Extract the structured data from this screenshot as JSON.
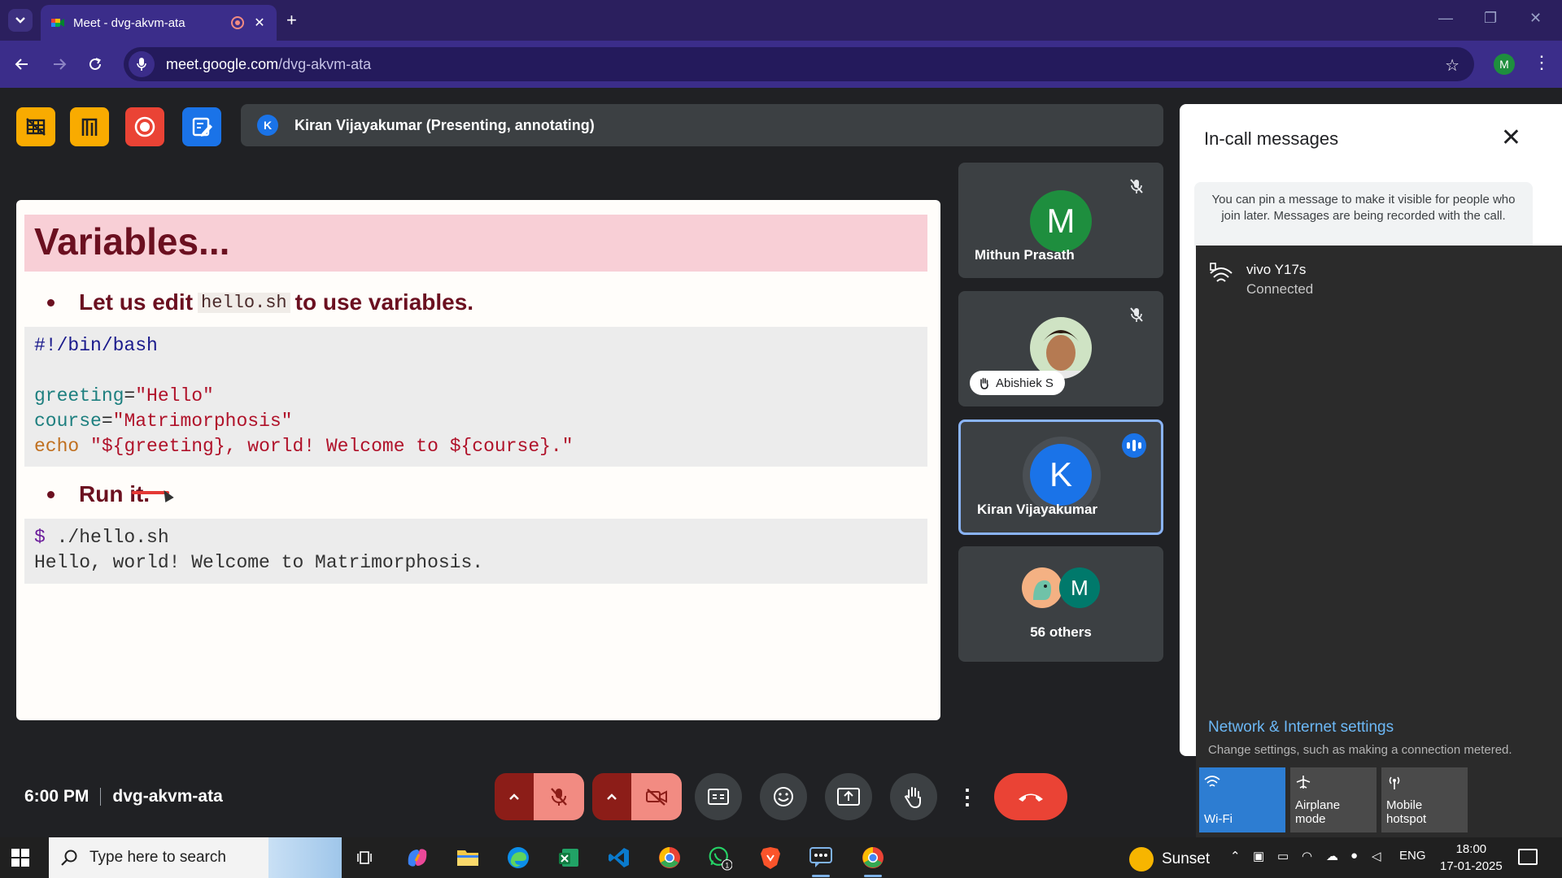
{
  "browser": {
    "tab_title": "Meet - dvg-akvm-ata",
    "url_host": "meet.google.com",
    "url_path": "/dvg-akvm-ata",
    "profile_initial": "M"
  },
  "meet": {
    "presenter_initial": "K",
    "presenter_text": "Kiran Vijayakumar (Presenting, annotating)",
    "time": "6:00 PM",
    "meeting_code": "dvg-akvm-ata"
  },
  "slide": {
    "title": "Variables...",
    "bullet1_pre": "Let us edit",
    "bullet1_code": "hello.sh",
    "bullet1_post": "to use variables.",
    "code": {
      "shebang": "#!/bin/bash",
      "l2_var": "greeting",
      "l2_eq": "=",
      "l2_val": "\"Hello\"",
      "l3_var": "course",
      "l3_eq": "=",
      "l3_val": "\"Matrimorphosis\"",
      "l4_kw": "echo",
      "l4_str": "\"${greeting}, world! Welcome to ${course}.\""
    },
    "bullet2": "Run it.",
    "run": {
      "prompt": "$",
      "cmd": " ./hello.sh",
      "output": "Hello, world! Welcome to Matrimorphosis."
    }
  },
  "participants": [
    {
      "name": "Mithun Prasath",
      "initial": "M",
      "color": "#1e8e3e",
      "muted": true
    },
    {
      "name": "Abishiek S",
      "muted": true
    },
    {
      "name": "Kiran Vijayakumar",
      "initial": "K",
      "color": "#1a73e8",
      "speaking": true
    },
    {
      "name": "56 others",
      "initial": "M",
      "color": "#00796b"
    }
  ],
  "chat_panel": {
    "title": "In-call messages",
    "note": "You can pin a message to make it visible for people who join later. Messages are being recorded with the call."
  },
  "wifi_flyout": {
    "network_name": "vivo Y17s",
    "network_status": "Connected",
    "settings_link": "Network & Internet settings",
    "settings_sub": "Change settings, such as making a connection metered.",
    "quick_actions": [
      "Wi-Fi",
      "Airplane mode",
      "Mobile hotspot"
    ]
  },
  "taskbar": {
    "search_placeholder": "Type here to search",
    "weather": "Sunset",
    "language": "ENG",
    "time": "18:00",
    "date": "17-01-2025",
    "whatsapp_badge": "1"
  },
  "colors": {
    "accent": "#1a73e8",
    "leave": "#ea4335",
    "muted_bg": "#f28b82",
    "slide_title": "#6b1020"
  }
}
